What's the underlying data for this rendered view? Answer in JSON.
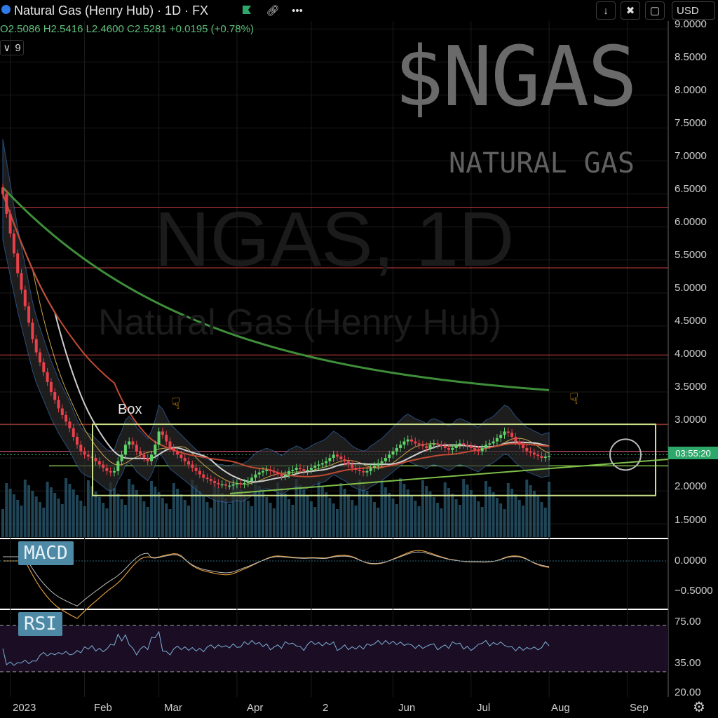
{
  "topbar": {
    "title": "Natural Gas (Henry Hub) · 1D · FX",
    "currency": "USD",
    "icons": [
      "drop-icon",
      "flag-icon",
      "link-icon",
      "more-icon",
      "arrow-down-icon",
      "collapse-icon",
      "maximize-icon"
    ]
  },
  "legend": {
    "ohlc": "O2.5086  H2.5416  L2.4600  C2.5281  +0.0195 (+0.78%)",
    "interval_value": "9"
  },
  "watermark": {
    "ticker": "$NGAS",
    "subtitle": "NATURAL GAS",
    "symbol": "NGAS, 1D",
    "name": "Natural Gas (Henry Hub)"
  },
  "annotations": {
    "box_label": "Box",
    "countdown": "03:55:20"
  },
  "indicators": {
    "macd_label": "MACD",
    "rsi_label": "RSI"
  },
  "colors": {
    "up": "#5fd46a",
    "down": "#e8414b",
    "ma200": "#3f8f3a",
    "ma_red": "#c24a34",
    "box": "#c9e08a",
    "resistance": "#c8403e"
  },
  "chart_data": [
    {
      "type": "line",
      "title": "Natural Gas (Henry Hub) · 1D · FX",
      "y_ticks": [
        "9.0000",
        "8.5000",
        "8.0000",
        "7.5000",
        "7.0000",
        "6.5000",
        "6.0000",
        "5.5000",
        "5.0000",
        "4.5000",
        "4.0000",
        "3.5000",
        "3.0000",
        "2.5000",
        "2.0000",
        "1.5000"
      ],
      "ylim": [
        1.3,
        9.1
      ],
      "x_ticks": [
        "2023",
        "Feb",
        "Mar",
        "Apr",
        "2",
        "Jun",
        "Jul",
        "Aug",
        "Sep"
      ],
      "x_tick_index": [
        2,
        22,
        42,
        63,
        83,
        105,
        126,
        147,
        168
      ],
      "series": [
        {
          "values": [
            6.5,
            6.2,
            5.9,
            5.6,
            5.3,
            5.05,
            4.8,
            4.55,
            4.3,
            4.1,
            3.95,
            3.8,
            3.65,
            3.5,
            3.38,
            3.25,
            3.15,
            3.05,
            2.95,
            2.82,
            2.7,
            2.6,
            2.55,
            2.52,
            2.5,
            2.45,
            2.4,
            2.35,
            2.3,
            2.28,
            2.3,
            2.45,
            2.55,
            2.7,
            2.75,
            2.7,
            2.6,
            2.55,
            2.5,
            2.45,
            2.55,
            2.7,
            2.9,
            2.85,
            2.75,
            2.65,
            2.6,
            2.55,
            2.5,
            2.45,
            2.4,
            2.35,
            2.3,
            2.25,
            2.2,
            2.18,
            2.15,
            2.12,
            2.1,
            2.1,
            2.08,
            2.08,
            2.1,
            2.12,
            2.1,
            2.12,
            2.15,
            2.2,
            2.25,
            2.28,
            2.3,
            2.32,
            2.3,
            2.28,
            2.25,
            2.22,
            2.25,
            2.3,
            2.32,
            2.35,
            2.33,
            2.3,
            2.32,
            2.35,
            2.38,
            2.4,
            2.42,
            2.45,
            2.5,
            2.55,
            2.52,
            2.48,
            2.45,
            2.4,
            2.35,
            2.32,
            2.3,
            2.28,
            2.3,
            2.35,
            2.38,
            2.42,
            2.45,
            2.5,
            2.55,
            2.6,
            2.65,
            2.7,
            2.75,
            2.78,
            2.75,
            2.72,
            2.7,
            2.68,
            2.65,
            2.7,
            2.72,
            2.7,
            2.68,
            2.65,
            2.62,
            2.65,
            2.7,
            2.72,
            2.7,
            2.68,
            2.65,
            2.62,
            2.6,
            2.65,
            2.7,
            2.72,
            2.75,
            2.8,
            2.85,
            2.9,
            2.88,
            2.82,
            2.75,
            2.7,
            2.65,
            2.6,
            2.58,
            2.55,
            2.53,
            2.5,
            2.52,
            2.53
          ]
        },
        {
          "name": "",
          "values": []
        }
      ]
    }
  ]
}
